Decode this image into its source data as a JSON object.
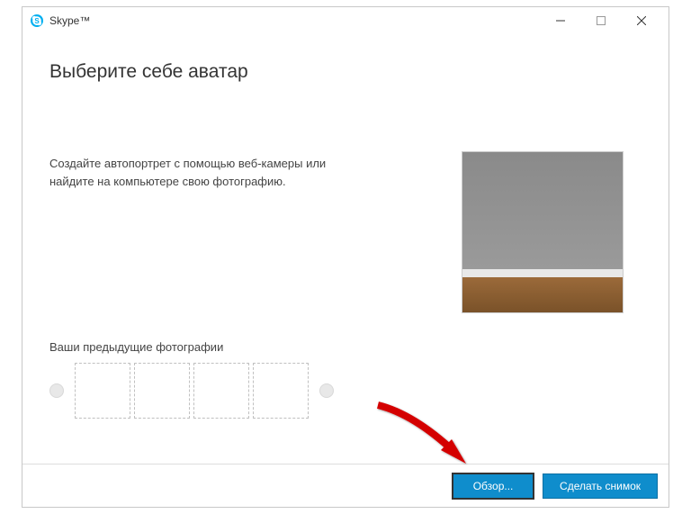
{
  "window": {
    "title": "Skype™"
  },
  "page": {
    "heading": "Выберите себе аватар",
    "instruction_line1": "Создайте автопортрет с помощью веб-камеры или",
    "instruction_line2": "найдите на компьютере свою фотографию.",
    "previous_photos_label": "Ваши предыдущие фотографии"
  },
  "buttons": {
    "browse": "Обзор...",
    "take_snapshot": "Сделать снимок"
  }
}
